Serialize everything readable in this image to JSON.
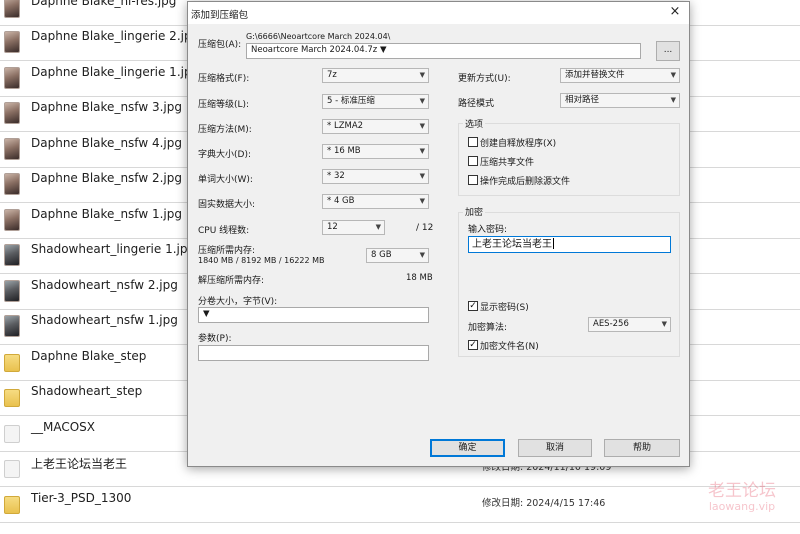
{
  "files": [
    {
      "name": "Daphne Blake_hi-res.jpg",
      "type": "image",
      "date": ""
    },
    {
      "name": "Daphne Blake_lingerie 2.jpg",
      "type": "image",
      "date": ""
    },
    {
      "name": "Daphne Blake_lingerie 1.jpg",
      "type": "image",
      "date": ""
    },
    {
      "name": "Daphne Blake_nsfw 3.jpg",
      "type": "image",
      "date": ""
    },
    {
      "name": "Daphne Blake_nsfw 4.jpg",
      "type": "image",
      "date": ""
    },
    {
      "name": "Daphne Blake_nsfw 2.jpg",
      "type": "image",
      "date": ""
    },
    {
      "name": "Daphne Blake_nsfw 1.jpg",
      "type": "image",
      "date": ""
    },
    {
      "name": "Shadowheart_lingerie 1.jpg",
      "type": "image",
      "date": ""
    },
    {
      "name": "Shadowheart_nsfw 2.jpg",
      "type": "image",
      "date": ""
    },
    {
      "name": "Shadowheart_nsfw 1.jpg",
      "type": "image",
      "date": ""
    },
    {
      "name": "Daphne Blake_step",
      "type": "folder",
      "date": ""
    },
    {
      "name": "Shadowheart_step",
      "type": "folder",
      "date": ""
    },
    {
      "name": "__MACOSX",
      "type": "folder-white",
      "date": ""
    },
    {
      "name": "上老王论坛当老王",
      "type": "folder-white",
      "date": "修改日期: 2024/11/10 19:09"
    },
    {
      "name": "Tier-3_PSD_1300",
      "type": "folder",
      "date": "修改日期: 2024/4/15 17:46"
    }
  ],
  "watermark": {
    "main": "老王论坛",
    "sub": "laowang.vip"
  },
  "dialog": {
    "title": "添加到压缩包",
    "close_icon": "×",
    "archive": {
      "label": "压缩包(A):",
      "path": "G:\\6666\\Neoartcore March 2024.04\\",
      "filename": "Neoartcore March 2024.04.7z",
      "browse_label": "..."
    },
    "options_left": [
      {
        "label": "压缩格式(F):",
        "value": "7z"
      },
      {
        "label": "压缩等级(L):",
        "value": "5 - 标准压缩"
      },
      {
        "label": "压缩方法(M):",
        "value": "* LZMA2"
      },
      {
        "label": "字典大小(D):",
        "value": "* 16 MB"
      },
      {
        "label": "单词大小(W):",
        "value": "* 32"
      },
      {
        "label": "固实数据大小:",
        "value": "* 4 GB"
      }
    ],
    "cpu": {
      "label": "CPU 线程数:",
      "value": "12",
      "max": "/ 12"
    },
    "mem_compress": {
      "label": "压缩所需内存:",
      "detail": "1840 MB / 8192 MB / 16222 MB",
      "value": "8 GB"
    },
    "mem_decompress": {
      "label": "解压缩所需内存:",
      "value": "18 MB"
    },
    "split": {
      "label": "分卷大小，字节(V):",
      "value": ""
    },
    "params": {
      "label": "参数(P):",
      "value": ""
    },
    "update": {
      "label": "更新方式(U):",
      "value": "添加并替换文件"
    },
    "pathmode": {
      "label": "路径模式",
      "value": "相对路径"
    },
    "options_group": {
      "title": "选项",
      "items": [
        {
          "label": "创建自释放程序(X)",
          "checked": false
        },
        {
          "label": "压缩共享文件",
          "checked": false
        },
        {
          "label": "操作完成后删除源文件",
          "checked": false
        }
      ]
    },
    "encryption": {
      "title": "加密",
      "password_label": "输入密码:",
      "password_value": "上老王论坛当老王",
      "show_password_label": "显示密码(S)",
      "show_password_checked": true,
      "method_label": "加密算法:",
      "method_value": "AES-256",
      "encrypt_names_label": "加密文件名(N)",
      "encrypt_names_checked": true
    },
    "buttons": {
      "ok": "确定",
      "cancel": "取消",
      "help": "帮助"
    }
  }
}
